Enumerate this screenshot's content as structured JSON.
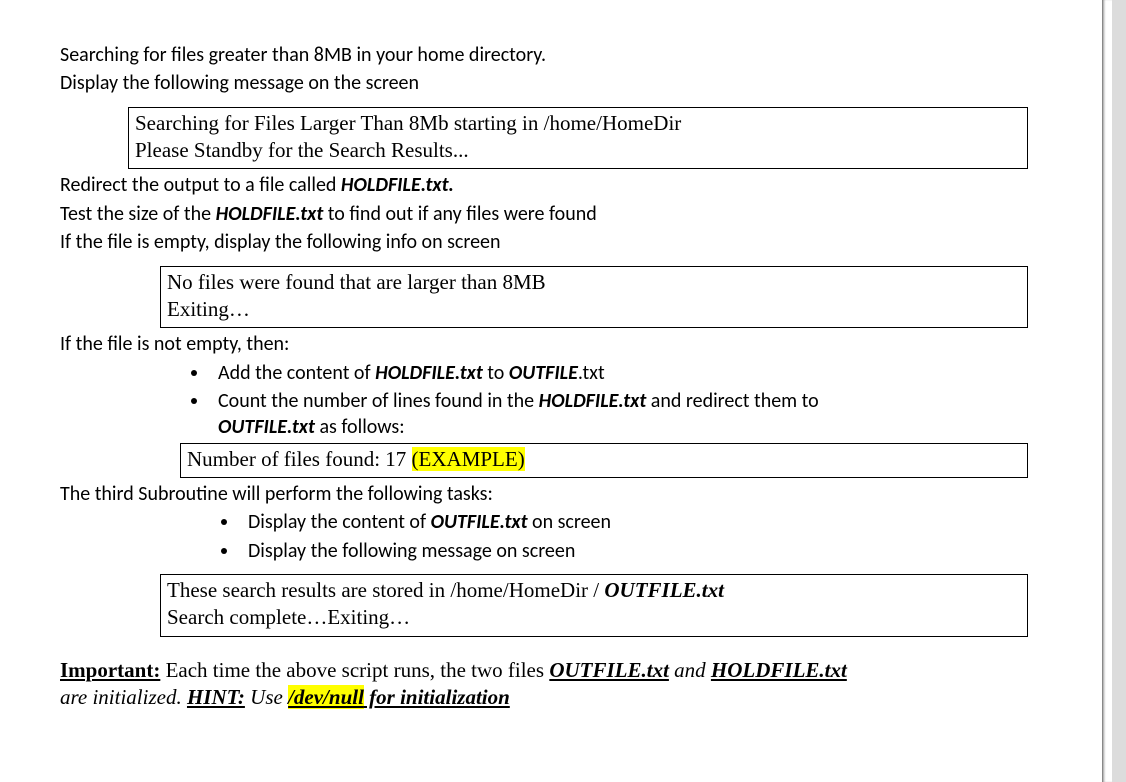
{
  "line1": "Searching for files greater than 8MB in your home directory.",
  "line2": "Display the following message on the screen",
  "box1a": "Searching for Files Larger Than 8Mb starting in /home/HomeDir",
  "box1b": "Please Standby for the Search Results...",
  "line3_pre": "Redirect the output to a file called ",
  "line3_b": "HOLDFILE.txt.",
  "line4_pre": "Test the size of the ",
  "line4_b": "HOLDFILE.txt",
  "line4_post": " to find out if any files were found",
  "line5": "If the file is empty, display the following info on screen",
  "box2a": "No files were found that are larger than 8MB",
  "box2b": "Exiting…",
  "line6": "If the file is not empty, then:",
  "b1_pre": "Add the content of ",
  "b1_b1": "HOLDFILE.txt",
  "b1_mid": " to ",
  "b1_b2": "OUTFILE",
  "b1_post": ".txt",
  "b2_pre": "Count the number of lines found in the ",
  "b2_b1": "HOLDFILE.txt",
  "b2_mid": " and redirect them to ",
  "b2_b2": "OUTFILE.txt",
  "b2_post": " as follows:",
  "box3a": "Number of files found: 17  ",
  "box3b": "(EXAMPLE)",
  "line7": "The third Subroutine will perform the following tasks:",
  "b3_pre": "Display the content of ",
  "b3_b": "OUTFILE.txt",
  "b3_post": " on screen",
  "b4": "Display the following message on screen",
  "box4a_pre": "These search results are stored in /home/HomeDir / ",
  "box4a_b": "OUTFILE.txt",
  "box4b": "Search complete…Exiting…",
  "imp_label": "Important:",
  "imp_t1": " Each time the above script runs, the two files ",
  "imp_b1": "OUTFILE.txt",
  "imp_t2": " and ",
  "imp_b2": "HOLDFILE.txt",
  "imp_t3": " are initialized. ",
  "hint_label": "HINT:",
  "hint_t1": " Use ",
  "hint_hl": "/dev/null",
  "hint_t2": " for initialization"
}
